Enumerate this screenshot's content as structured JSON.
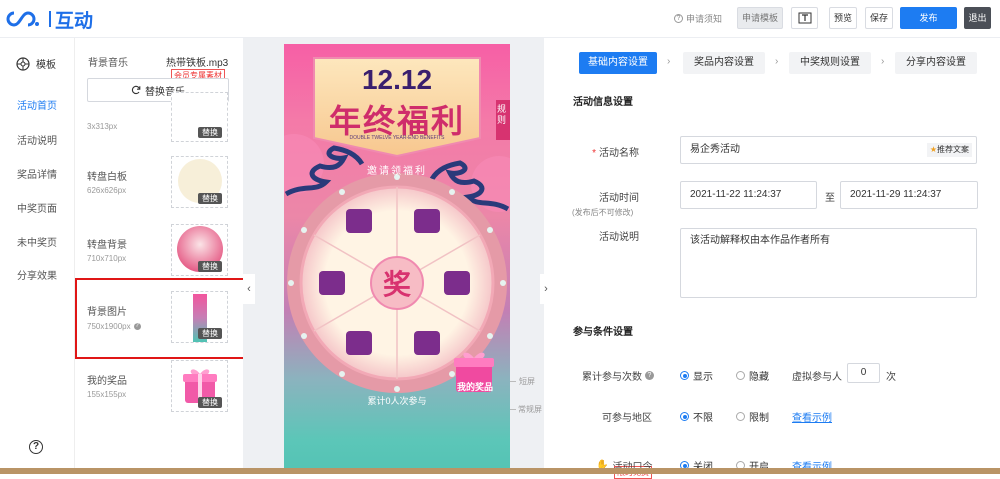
{
  "header": {
    "logo_text": "互动",
    "apply_notice": "申请须知",
    "buttons": {
      "apply_template": "申请模板",
      "preview": "预览",
      "save": "保存",
      "publish": "发布",
      "exit": "退出"
    }
  },
  "sidebar": {
    "template": "模板",
    "items": [
      "活动首页",
      "活动说明",
      "奖品详情",
      "中奖页面",
      "未中奖页",
      "分享效果"
    ],
    "help": "?"
  },
  "assets": {
    "music_label": "背景音乐",
    "music_file": "热带铁板.mp3",
    "vip_tag": "会员专属素材",
    "swap_music": "替换音乐",
    "swap": "替换",
    "items": [
      {
        "label": "",
        "size": "3x313px"
      },
      {
        "label": "转盘白板",
        "size": "626x626px"
      },
      {
        "label": "转盘背景",
        "size": "710x710px"
      },
      {
        "label": "背景图片",
        "size": "750x1900px"
      },
      {
        "label": "我的奖品",
        "size": "155x155px"
      }
    ]
  },
  "preview": {
    "date": "12.12",
    "banner_title": "年终福利",
    "banner_sub": "DOUBLE TWELVE YEAR-END BENEFITS",
    "side_tag": "规则",
    "invite": "邀请领福利",
    "center": "奖",
    "count_text": "累计0人次参与",
    "my_prize": "我的奖品",
    "short_screen": "短屏",
    "normal_screen": "常规屏"
  },
  "form": {
    "steps": [
      "基础内容设置",
      "奖品内容设置",
      "中奖规则设置",
      "分享内容设置"
    ],
    "section_activity": "活动信息设置",
    "name_label": "活动名称",
    "name_value": "易企秀活动",
    "recommend": "推荐文案",
    "time_label": "活动时间",
    "time_hint": "(发布后不可修改)",
    "start_time": "2021-11-22 11:24:37",
    "to": "至",
    "end_time": "2021-11-29 11:24:37",
    "desc_label": "活动说明",
    "desc_value": "该活动解释权由本作品作者所有",
    "section_participation": "参与条件设置",
    "count_label": "累计参与次数",
    "show": "显示",
    "hide": "隐藏",
    "virtual_label": "虚拟参与人",
    "virtual_value": "0",
    "unit": "次",
    "region_label": "可参与地区",
    "unlimited": "不限",
    "limited": "限制",
    "view_example": "查看示例",
    "free_tag": "限时免费",
    "password_label": "活动口令",
    "off": "关闭",
    "on": "开启"
  },
  "colors": {
    "accent": "#1d7cf2",
    "highlight": "#e01616"
  }
}
